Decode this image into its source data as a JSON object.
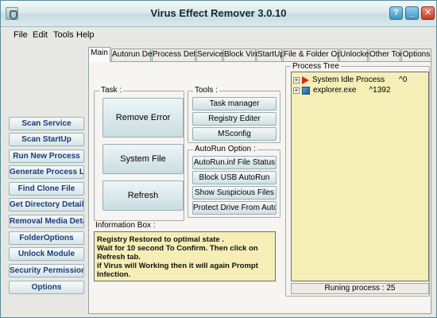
{
  "window": {
    "title": "Virus Effect Remover 3.0.10"
  },
  "title_buttons": {
    "help": "?",
    "minimize": "_",
    "close": "✕"
  },
  "menu": [
    "File",
    "Edit",
    "Tools",
    "Help"
  ],
  "nav": [
    "Scan Service",
    "Scan StartUp",
    "Run New Process",
    "Generate Process List",
    "Find Clone File",
    "Get Directory Detail",
    "Removal Media Detail",
    "FolderOptions",
    "Unlock Module",
    "Security Permission",
    "Options"
  ],
  "tabs": [
    "Main",
    "Autorun Detail",
    "Process Detail",
    "Service",
    "Block Virus",
    "StartUp",
    "File & Folder Option",
    "Unlocker",
    "Other Tool",
    "Options"
  ],
  "task": {
    "label": "Task :",
    "buttons": [
      "Remove Error",
      "System File Checker",
      "Refresh"
    ]
  },
  "tools": {
    "label": "Tools :",
    "buttons": [
      "Task manager",
      "Registry Editer",
      "MSconfig"
    ]
  },
  "autorun": {
    "label": "AutoRun Option :",
    "buttons": [
      "AutoRun.inf File Status",
      "Block USB AutoRun",
      "Show Suspicious Files",
      "Protect Drive From Autorun"
    ]
  },
  "info": {
    "label": "Information Box :",
    "lines": [
      "Registry Restored to optimal state .",
      "Wait for 10 second To Confirm. Then click on Refresh tab.",
      "if Virus will Working then it will again Prompt Infection."
    ]
  },
  "process_tree": {
    "label": "Process Tree",
    "items": [
      {
        "name": "System Idle Process",
        "pid": "^0"
      },
      {
        "name": "explorer.exe",
        "pid": "^1392"
      }
    ],
    "status": "Runing process : 25"
  }
}
